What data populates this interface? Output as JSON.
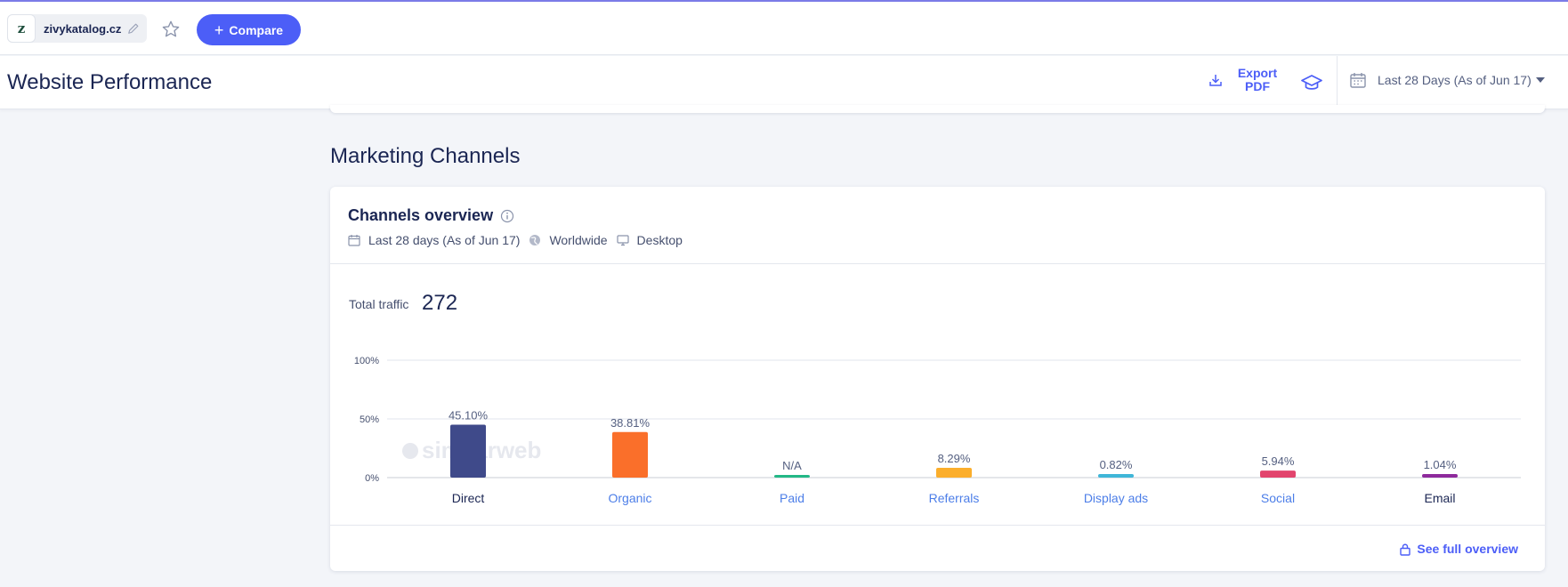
{
  "topbar": {
    "site_name": "zivykatalog.cz",
    "favicon_letter": "z",
    "compare_label": "Compare",
    "compare_icon": "plus-icon"
  },
  "header": {
    "title": "Website Performance",
    "export_label": "Export PDF",
    "date_range": "Last 28 Days (As of Jun 17)"
  },
  "section": {
    "title": "Marketing Channels"
  },
  "card": {
    "title": "Channels overview",
    "meta": {
      "period": "Last 28 days (As of Jun 17)",
      "region": "Worldwide",
      "device": "Desktop"
    },
    "total_label": "Total traffic",
    "total_value": "272",
    "watermark": "similarweb",
    "footer_link": "See full overview"
  },
  "colors": {
    "accent": "#4c5ef7",
    "link": "#4c7ee8"
  },
  "chart_data": {
    "type": "bar",
    "categories": [
      "Direct",
      "Organic",
      "Paid",
      "Referrals",
      "Display ads",
      "Social",
      "Email"
    ],
    "values": [
      45.1,
      38.81,
      null,
      8.29,
      0.82,
      5.94,
      1.04
    ],
    "value_labels": [
      "45.10%",
      "38.81%",
      "N/A",
      "8.29%",
      "0.82%",
      "5.94%",
      "1.04%"
    ],
    "colors": [
      "#3f4a8a",
      "#fa6f2a",
      "#23b886",
      "#fbae2c",
      "#3fb6d8",
      "#e2446d",
      "#8e2a9c"
    ],
    "category_linked": [
      false,
      true,
      true,
      true,
      true,
      true,
      false
    ],
    "y_ticks": [
      "100%",
      "50%",
      "0%"
    ],
    "ylim": [
      0,
      100
    ],
    "grid": true
  }
}
